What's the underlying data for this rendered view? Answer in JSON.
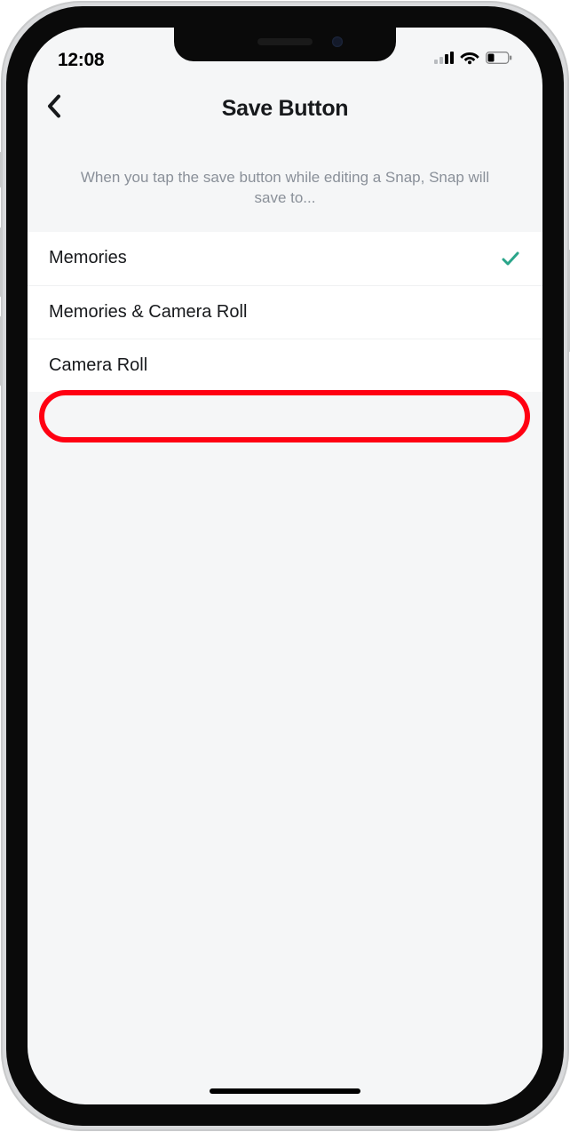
{
  "status": {
    "time": "12:08"
  },
  "header": {
    "title": "Save Button"
  },
  "description": "When you tap the save button while editing a Snap, Snap will save to...",
  "options": [
    {
      "label": "Memories",
      "selected": true
    },
    {
      "label": "Memories & Camera Roll",
      "selected": false
    },
    {
      "label": "Camera Roll",
      "selected": false
    }
  ],
  "highlightedOptionIndex": 2
}
